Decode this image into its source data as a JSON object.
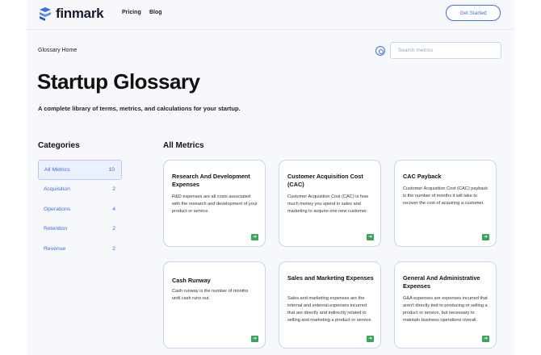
{
  "header": {
    "brand": "finmark",
    "nav": [
      "Pricing",
      "Blog"
    ],
    "cta_label": "Get Started"
  },
  "breadcrumb": "Glossary Home",
  "search": {
    "placeholder": "Search metrics"
  },
  "title": "Startup Glossary",
  "subtitle": "A complete library of terms, metrics, and calculations for your startup.",
  "categories": {
    "heading": "Categories",
    "items": [
      {
        "label": "All Metrics",
        "count": "10",
        "active": true
      },
      {
        "label": "Acquisition",
        "count": "2"
      },
      {
        "label": "Operations",
        "count": "4"
      },
      {
        "label": "Retention",
        "count": "2"
      },
      {
        "label": "Revenue",
        "count": "2"
      }
    ]
  },
  "metrics": {
    "heading": "All Metrics",
    "cards": [
      {
        "title": "Research And Development Expenses",
        "desc": "R&D expenses are all costs associated with the research and development of your product or service."
      },
      {
        "title": "Customer Acquisition Cost (CAC)",
        "desc": "Customer Acquisition Cost (CAC) is how much money you spend in sales and marketing to acquire one new customer."
      },
      {
        "title": "CAC Payback",
        "desc": "Customer Acquisition Cost (CAC) payback is the number of months it will take to recover the cost of acquiring a customer."
      },
      {
        "title": "Cash Runway",
        "desc": "Cash runway is the number of months until cash runs out."
      },
      {
        "title": "Sales and Marketing Expenses",
        "desc": "Sales and marketing expenses are the internal and external expenses incurred that are directly and indirectly related to selling and marketing a product or service."
      },
      {
        "title": "General And Administrative Expenses",
        "desc": "G&A expenses are expenses incurred that aren't directly tied to producing or selling a product or service, but necessary to maintain business operations overall."
      }
    ]
  },
  "colors": {
    "accent": "#3b6ee8",
    "arrow": "#3aa55a",
    "card_border": "#c5d7ef"
  },
  "icons": {
    "logo": "finmark-logo-icon",
    "search": "search-icon",
    "card_arrow": "arrow-right-icon"
  }
}
